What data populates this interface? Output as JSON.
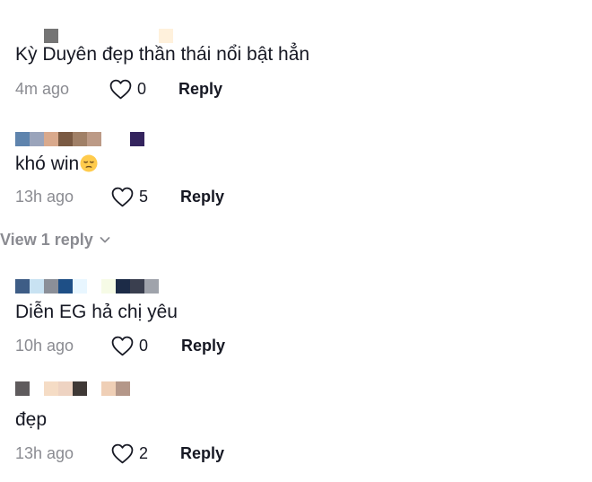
{
  "comments": [
    {
      "username_pixels": [
        "#ffffff",
        "#ffffff",
        "#757575",
        "#ffffff",
        "#ffffff",
        "#ffffff",
        "#ffffff",
        "#ffffff",
        "#ffffff",
        "#ffffff",
        "#fff1dc"
      ],
      "text": "Kỳ Duyên đẹp thần thái nổi bật hẳn",
      "time": "4m ago",
      "likes": "0",
      "reply_label": "Reply"
    },
    {
      "username_pixels": [
        "#5f84ad",
        "#9aa4bb",
        "#d9a98c",
        "#7a5a43",
        "#a08067",
        "#bc9a86",
        "#ffffff",
        "#ffffff",
        "#34245e"
      ],
      "text": "khó win",
      "emoji": "pensive-face",
      "time": "13h ago",
      "likes": "5",
      "reply_label": "Reply"
    },
    {
      "username_pixels": [
        "#3e5d86",
        "#c8e2f2",
        "#8b8f98",
        "#1e4f86",
        "#e8f6ff",
        "#ffffff",
        "#f6fbe6",
        "#1c2b47",
        "#3a3f4f",
        "#9fa3ab"
      ],
      "text": "Diễn EG hả chị yêu",
      "time": "10h ago",
      "likes": "0",
      "reply_label": "Reply"
    },
    {
      "username_pixels": [
        "#5f5b5d",
        "#ffffff",
        "#f5dcc5",
        "#eed3c2",
        "#3f3936",
        "#ffffff",
        "#efcfb6",
        "#b49789"
      ],
      "text": "đẹp",
      "time": "13h ago",
      "likes": "2",
      "reply_label": "Reply"
    }
  ],
  "view_replies_label": "View 1 reply",
  "colors": {
    "text": "#161823",
    "muted": "#8a8b91",
    "background": "#ffffff"
  }
}
